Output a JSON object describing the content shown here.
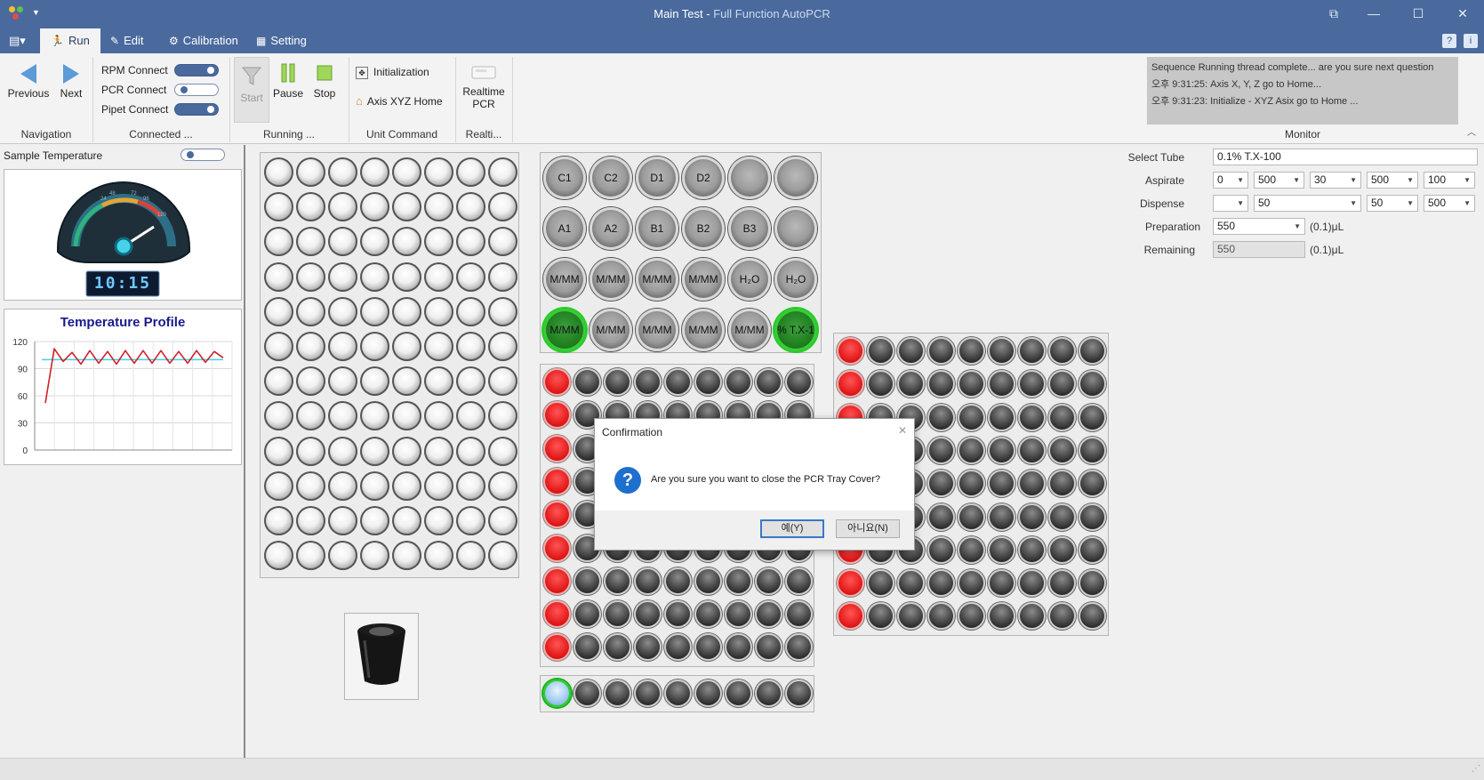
{
  "window": {
    "title": "Main Test",
    "title_separator": " - ",
    "subtitle": "Full Function AutoPCR",
    "controls": {
      "restore_alt": "⧉",
      "minimize": "—",
      "maximize": "☐",
      "close": "✕"
    }
  },
  "tabs": [
    {
      "label": "Run",
      "icon": "run-icon",
      "active": true
    },
    {
      "label": "Edit",
      "icon": "edit-icon",
      "active": false
    },
    {
      "label": "Calibration",
      "icon": "calibration-icon",
      "active": false
    },
    {
      "label": "Setting",
      "icon": "setting-icon",
      "active": false
    }
  ],
  "ribbon": {
    "navigation": {
      "previous": "Previous",
      "next": "Next",
      "group": "Navigation"
    },
    "connected": {
      "rpm": "RPM Connect",
      "rpm_on": true,
      "pcr": "PCR Connect",
      "pcr_on": false,
      "pipet": "Pipet Connect",
      "pipet_on": true,
      "group": "Connected ..."
    },
    "running": {
      "start": "Start",
      "pause": "Pause",
      "stop": "Stop",
      "group": "Running ..."
    },
    "unit_command": {
      "initialization": "Initialization",
      "axis_home": "Axis XYZ Home",
      "group": "Unit Command"
    },
    "realtime": {
      "line1": "Realtime",
      "line2": "PCR",
      "group": "Realti..."
    },
    "monitor": {
      "group": "Monitor",
      "lines": [
        "Sequence Running thread complete... are you sure next question",
        "오후 9:31:25: Axis X, Y, Z go to Home...",
        "오후 9:31:23: Initialize - XYZ Asix go to Home ..."
      ]
    }
  },
  "left": {
    "sample_temperature": "Sample Temperature",
    "sample_toggle_on": false,
    "gauge_digits": "10:15",
    "gauge_ticks": [
      "24",
      "48",
      "72",
      "96",
      "120"
    ],
    "profile_title": "Temperature Profile"
  },
  "chart_data": {
    "type": "line",
    "title": "Temperature Profile",
    "xlabel": "",
    "ylabel": "",
    "ylim": [
      0,
      120
    ],
    "yticks": [
      0,
      30,
      60,
      90,
      120
    ],
    "grid": true,
    "series": [
      {
        "color": "#d0202a",
        "y": [
          52,
          112,
          98,
          108,
          95,
          110,
          96,
          109,
          95,
          110,
          96,
          110,
          96,
          110,
          96,
          109,
          96,
          110,
          97,
          109,
          102
        ]
      },
      {
        "color": "#3fd3e8",
        "y": [
          100,
          100
        ]
      }
    ]
  },
  "reagent_tray": {
    "rows": [
      [
        "C1",
        "C2",
        "D1",
        "D2",
        "",
        ""
      ],
      [
        "A1",
        "A2",
        "B1",
        "B2",
        "B3",
        ""
      ],
      [
        "M/MM",
        "M/MM",
        "M/MM",
        "M/MM",
        "H₂O",
        "H₂O"
      ],
      [
        "M/MM",
        "M/MM",
        "M/MM",
        "M/MM",
        "M/MM",
        "% T.X-1"
      ]
    ],
    "green": [
      [
        3,
        0
      ],
      [
        3,
        5
      ]
    ]
  },
  "form": {
    "select_tube_label": "Select Tube",
    "select_tube_value": "0.1% T.X-100",
    "aspirate_label": "Aspirate",
    "aspirate_values": [
      "0",
      "500",
      "30",
      "500",
      "100"
    ],
    "dispense_label": "Dispense",
    "dispense_values": [
      "",
      "50",
      "50",
      "500"
    ],
    "preparation_label": "Preparation",
    "preparation_value": "550",
    "preparation_unit": "(0.1)μL",
    "remaining_label": "Remaining",
    "remaining_value": "550",
    "remaining_unit": "(0.1)μL"
  },
  "dialog": {
    "title": "Confirmation",
    "close": "✕",
    "icon": "question-icon",
    "message": "Are you sure you want to close the PCR Tray Cover?",
    "yes": "예(Y)",
    "no": "아니요(N)"
  },
  "colors": {
    "titlebar": "#4a6a9e",
    "accent": "#2b5797",
    "red_well": "#e31b1b",
    "green_well": "#1f7f1f",
    "chart_line": "#d0202a",
    "chart_ref": "#3fd3e8"
  }
}
